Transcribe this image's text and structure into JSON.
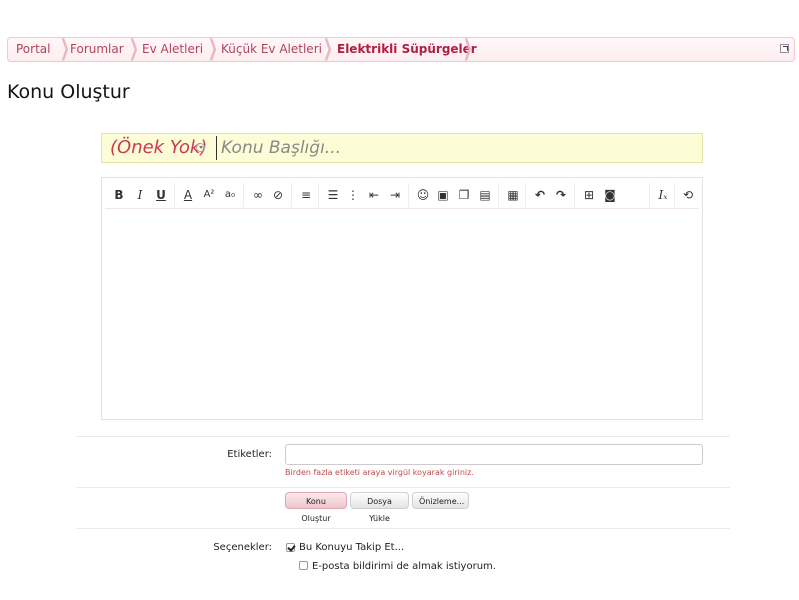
{
  "breadcrumb": {
    "items": [
      "Portal",
      "Forumlar",
      "Ev Aletleri",
      "Küçük Ev Aletleri",
      "Elektrikli Süpürgeler"
    ]
  },
  "page": {
    "title": "Konu Oluştur"
  },
  "thread_title": {
    "prefix": "(Önek Yok)",
    "placeholder": "Konu Başlığı...",
    "value": ""
  },
  "toolbar": {
    "icons": [
      "bold-icon",
      "italic-icon",
      "underline-icon",
      "text-color-icon",
      "superscript-icon",
      "subscript-icon",
      "link-icon",
      "unlink-icon",
      "align-left-icon",
      "bullet-list-icon",
      "numbered-list-icon",
      "outdent-icon",
      "indent-icon",
      "smiley-icon",
      "image-icon",
      "media-icon",
      "quote-icon",
      "save-draft-icon",
      "undo-icon",
      "redo-icon",
      "toggle-bbcode-icon",
      "screenshot-icon",
      "remove-format-icon",
      "help-icon"
    ]
  },
  "form": {
    "tags_label": "Etiketler:",
    "tags_hint": "Birden fazla etiketi araya virgül koyarak giriniz.",
    "tags_value": "",
    "buttons": {
      "create": "Konu Oluştur",
      "upload": "Dosya Yükle",
      "preview": "Önizleme..."
    },
    "options_label": "Seçenekler:",
    "options": [
      {
        "label": "Bu Konuyu Takip Et...",
        "checked": true
      },
      {
        "label": "E-posta bildirimi de almak istiyorum.",
        "checked": false
      }
    ]
  },
  "colors": {
    "accent": "#b01e44",
    "link": "#b0435c",
    "title_bg": "#fcfcd6",
    "hint": "#c24a4a"
  }
}
